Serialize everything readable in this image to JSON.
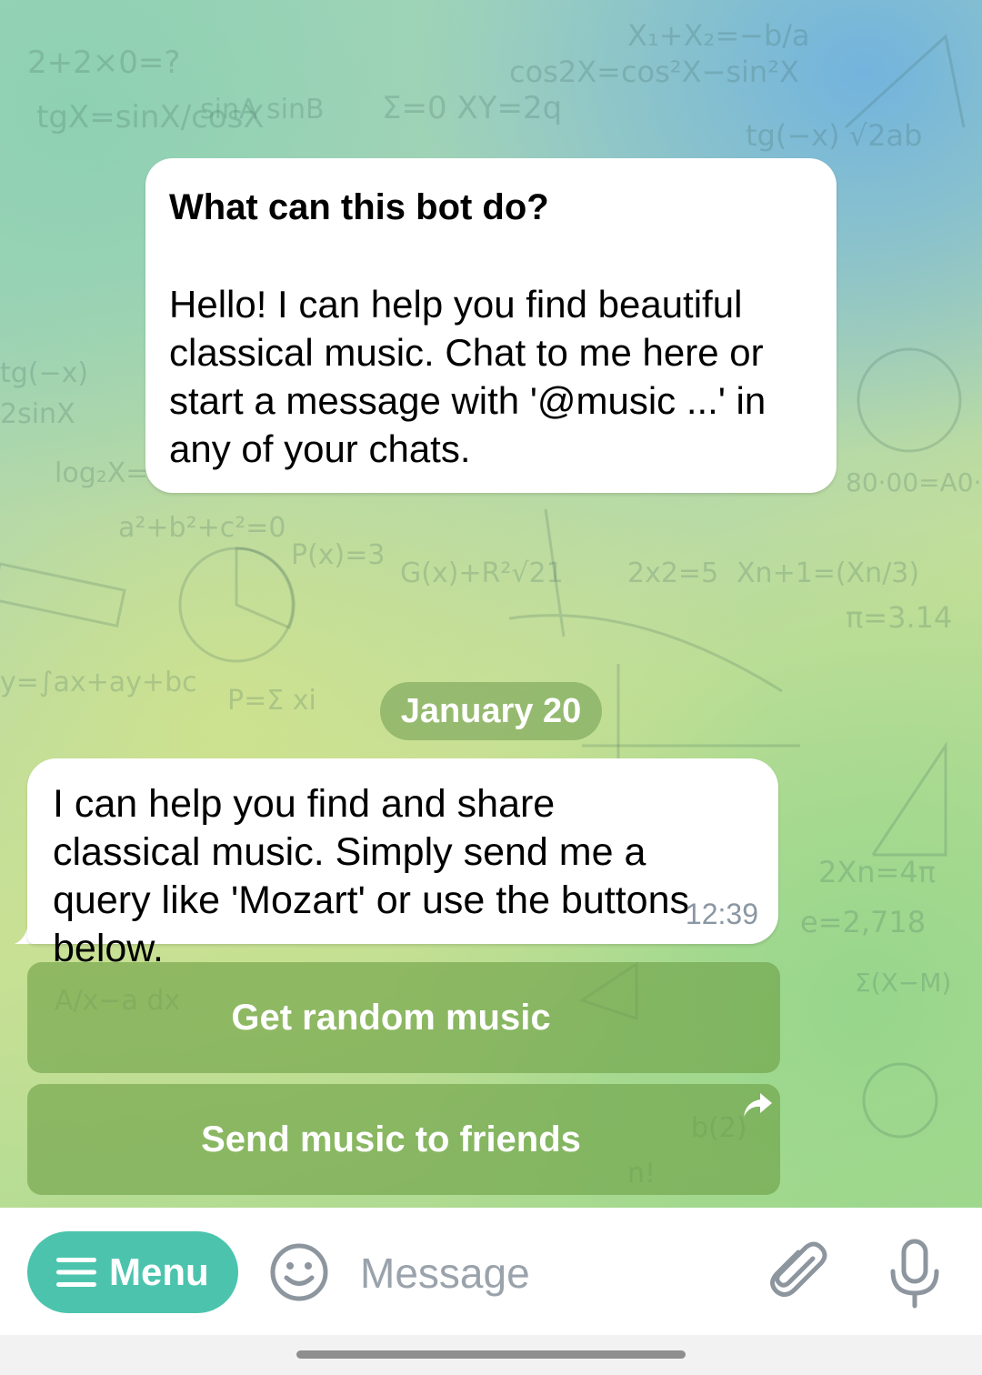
{
  "bot_info": {
    "title": "What can this bot do?",
    "body": "Hello! I can help you find beautiful classical music. Chat to me here or start a message with '@music ...' in any of your chats."
  },
  "date_separator": "January 20",
  "message": {
    "text": "I can help you find and share classical music. Simply send me a query like 'Mozart' or use the buttons below.",
    "time": "12:39"
  },
  "keyboard": {
    "buttons": [
      {
        "label": "Get random music",
        "icon": null
      },
      {
        "label": "Send music to friends",
        "icon": "share-arrow-icon"
      }
    ]
  },
  "input_bar": {
    "menu_label": "Menu",
    "placeholder": "Message",
    "icons": [
      "hamburger-icon",
      "emoji-icon",
      "attach-icon",
      "microphone-icon"
    ]
  },
  "colors": {
    "menu_button": "#4cc4ad",
    "keyboard_button": "#7fae55",
    "timestamp": "#8a97a3"
  }
}
